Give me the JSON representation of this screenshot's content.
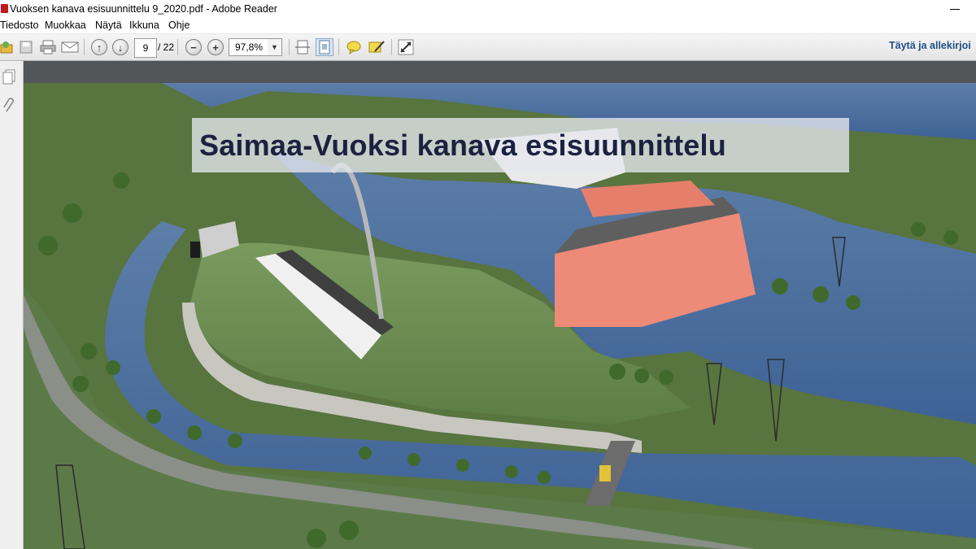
{
  "window": {
    "title": "Vuoksen kanava esisuunnittelu 9_2020.pdf - Adobe Reader"
  },
  "menu": [
    "Tiedosto",
    "Muokkaa",
    "Näytä",
    "Ikkuna",
    "Ohje"
  ],
  "toolbar": {
    "page_current": "9",
    "page_total": "/ 22",
    "zoom": "97,8%",
    "fill_sign": "Täytä ja allekirjoi"
  },
  "document": {
    "title": "Saimaa-Vuoksi kanava esisuunnittelu"
  }
}
